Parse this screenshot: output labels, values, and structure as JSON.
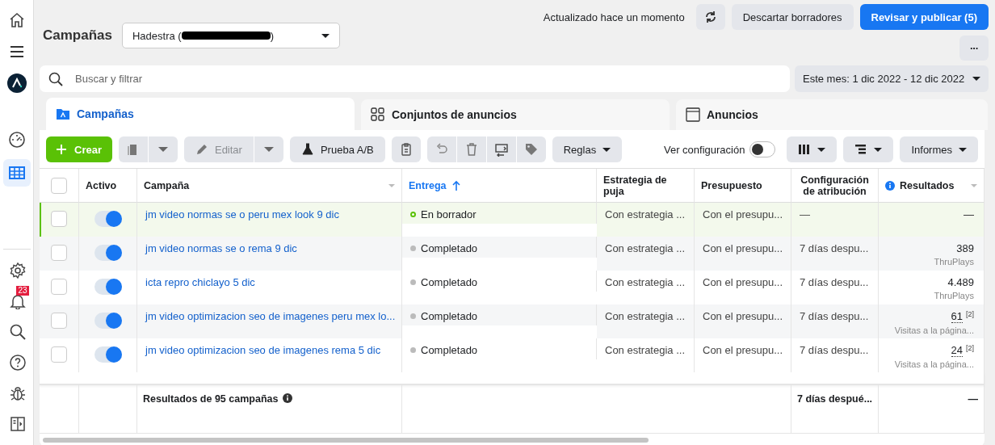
{
  "sidebar": {
    "items": [
      {
        "kind": "home",
        "selected": false
      },
      {
        "kind": "menu",
        "selected": false
      },
      {
        "kind": "avatar",
        "selected": false
      },
      {
        "kind": "gauge",
        "selected": false
      },
      {
        "kind": "table",
        "selected": true
      }
    ],
    "bottom_items": [
      {
        "kind": "settings"
      },
      {
        "kind": "bell",
        "badge": "23"
      },
      {
        "kind": "search"
      },
      {
        "kind": "help"
      },
      {
        "kind": "bug"
      },
      {
        "kind": "panel"
      }
    ]
  },
  "header": {
    "title": "Campañas",
    "account": {
      "name": "Hadestra (",
      "suffix": ")",
      "redacted": true
    },
    "status": "Actualizado hace un momento",
    "discard": "Descartar borradores",
    "publish": "Revisar y publicar (5)",
    "more": "···"
  },
  "search": {
    "placeholder": "Buscar y filtrar"
  },
  "date_range": "Este mes: 1 dic 2022 - 12 dic 2022",
  "tabs": [
    {
      "label": "Campañas",
      "kind": "campaigns",
      "selected": true
    },
    {
      "label": "Conjuntos de anuncios",
      "kind": "adsets",
      "selected": false
    },
    {
      "label": "Anuncios",
      "kind": "ads",
      "selected": false
    }
  ],
  "toolbar": {
    "create": "Crear",
    "edit": {
      "label": "Editar",
      "disabled": true
    },
    "ab_test": "Prueba A/B",
    "rules": "Reglas",
    "view_settings": {
      "label": "Ver configuración",
      "on": false
    },
    "reports": "Informes"
  },
  "table": {
    "all_checked": false,
    "columns": [
      {
        "label": "Activo",
        "sorted": false,
        "menu": false
      },
      {
        "label": "Campaña",
        "sorted": false,
        "menu": true
      },
      {
        "label": "Entrega",
        "sorted": true,
        "menu": false
      },
      {
        "label": "Estrategia de puja",
        "sorted": false,
        "menu": false
      },
      {
        "label": "Presupuesto",
        "sorted": false,
        "menu": false
      },
      {
        "label": "Configuración de atribución",
        "sorted": false,
        "menu": false
      },
      {
        "label": "Resultados",
        "sorted": false,
        "menu": true,
        "info": true
      }
    ],
    "rows": [
      {
        "selected": true,
        "checked": false,
        "on": true,
        "name": "jm video normas se o peru mex look 9 dic",
        "status": {
          "label": "En borrador",
          "kind": "draft"
        },
        "bid": "Con estrategia ...",
        "budget": "Con el presupu...",
        "attribution": "—",
        "result": {
          "value": "—"
        }
      },
      {
        "selected": false,
        "checked": false,
        "on": true,
        "name": "jm video normas se o rema 9 dic",
        "status": {
          "label": "Completado",
          "kind": "completed"
        },
        "bid": "Con estrategia ...",
        "budget": "Con el presupu...",
        "attribution": "7 días despu...",
        "result": {
          "value": "389",
          "unit": "ThruPlays"
        }
      },
      {
        "selected": false,
        "checked": false,
        "on": true,
        "name": "icta repro chiclayo 5 dic",
        "status": {
          "label": "Completado",
          "kind": "completed"
        },
        "bid": "Con estrategia ...",
        "budget": "Con el presupu...",
        "attribution": "7 días despu...",
        "result": {
          "value": "4.489",
          "unit": "ThruPlays"
        }
      },
      {
        "selected": false,
        "checked": false,
        "on": true,
        "name": "jm video optimizacion seo de imagenes peru mex lo...",
        "status": {
          "label": "Completado",
          "kind": "completed"
        },
        "bid": "Con estrategia ...",
        "budget": "Con el presupu...",
        "attribution": "7 días despu...",
        "result": {
          "value": "61",
          "note": "[2]",
          "unit": "Visitas a la página..."
        }
      },
      {
        "selected": false,
        "checked": false,
        "on": true,
        "name": "jm video optimizacion seo de imagenes rema 5 dic",
        "status": {
          "label": "Completado",
          "kind": "completed"
        },
        "bid": "Con estrategia ...",
        "budget": "Con el presupu...",
        "attribution": "7 días despu...",
        "result": {
          "value": "24",
          "note": "[2]",
          "unit": "Visitas a la página..."
        }
      }
    ],
    "footer": {
      "summary": "Resultados de 95 campañas",
      "attribution": "7 días despué...",
      "result": "—"
    }
  }
}
